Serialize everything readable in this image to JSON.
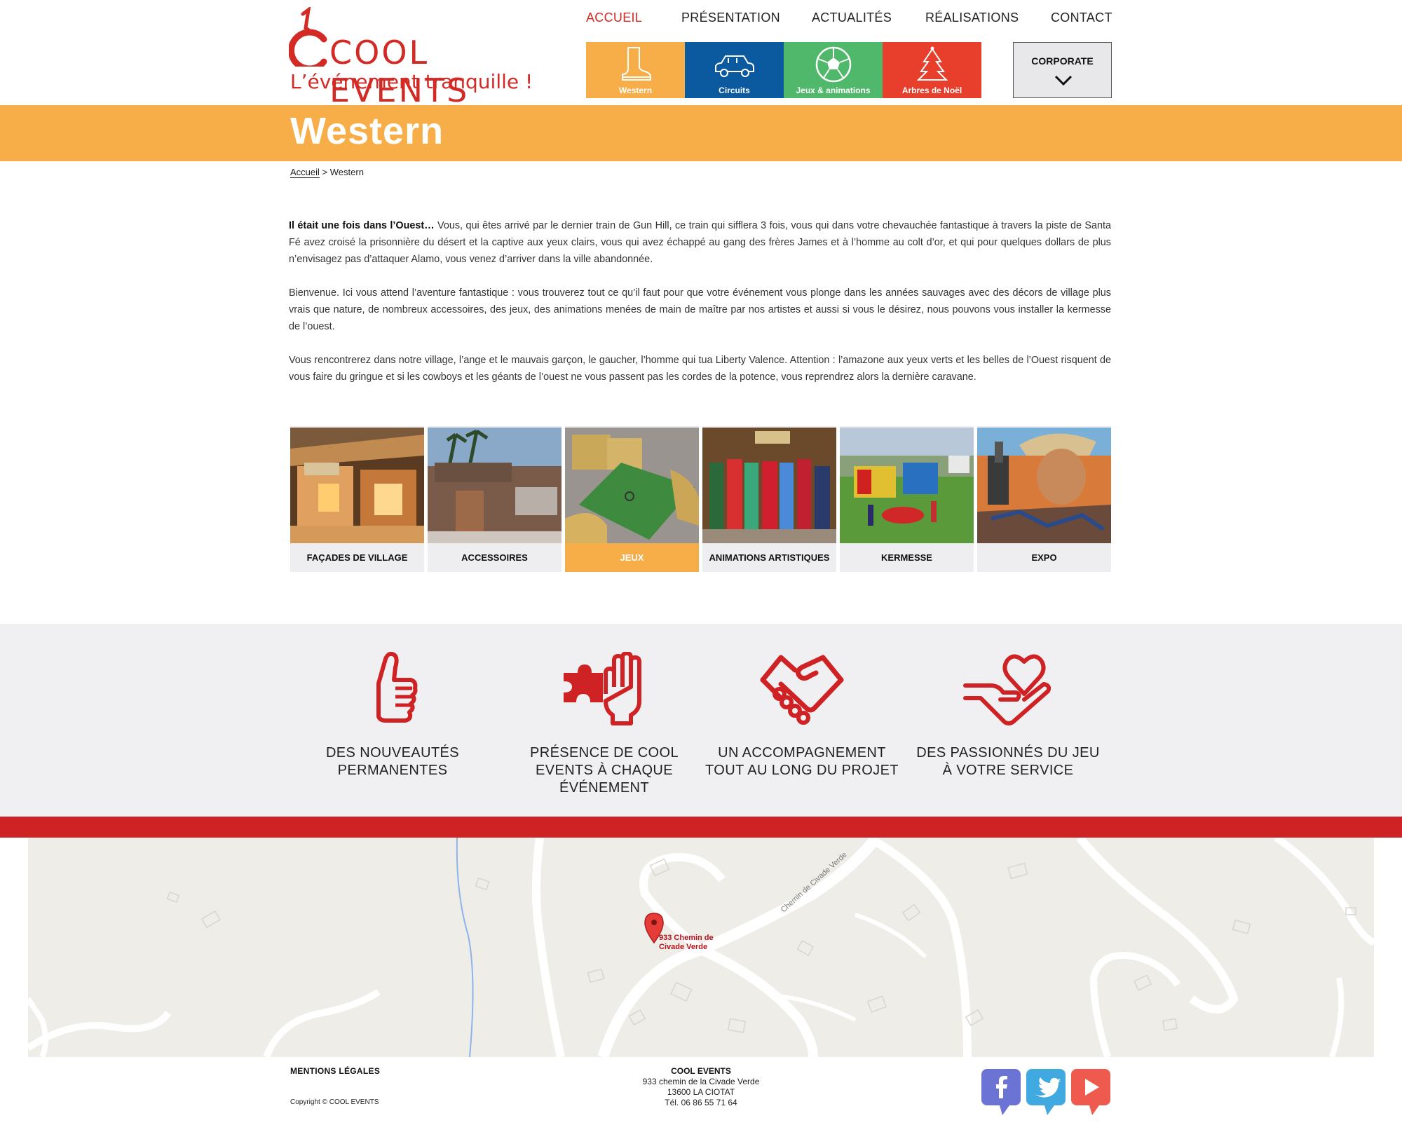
{
  "brand": {
    "name": "COOL EVENTS",
    "tagline": "L’événement tranquille !",
    "accent": "#d42a25",
    "orange": "#f7ae48"
  },
  "nav": {
    "items": [
      {
        "label": "ACCUEIL",
        "active": true
      },
      {
        "label": "PRÉSENTATION"
      },
      {
        "label": "ACTUALITÉS"
      },
      {
        "label": "RÉALISATIONS"
      },
      {
        "label": "CONTACT"
      }
    ]
  },
  "categories": [
    {
      "label": "Western",
      "icon": "cowboy-boot-icon",
      "color": "#f7ae48"
    },
    {
      "label": "Circuits",
      "icon": "car-icon",
      "color": "#0b5aa0"
    },
    {
      "label": "Jeux & animations",
      "icon": "soccer-ball-icon",
      "color": "#4fb86b"
    },
    {
      "label": "Arbres de Noël",
      "icon": "christmas-tree-icon",
      "color": "#e83e2c"
    }
  ],
  "corporate": {
    "label": "CORPORATE",
    "icon": "chevron-down-icon"
  },
  "page": {
    "title": "Western"
  },
  "breadcrumb": {
    "home": "Accueil",
    "sep": ">",
    "current": "Western"
  },
  "content": {
    "p1_lead": "Il était une fois dans l’Ouest…",
    "p1_body": " Vous, qui êtes arrivé par le dernier train de Gun Hill, ce train qui sifflera 3 fois, vous qui dans votre chevauchée fantastique à travers la piste de Santa Fé  avez croisé la prisonnière du désert et la captive aux yeux clairs, vous qui avez échappé au gang des frères James et à l’homme au colt d’or, et qui pour quelques dollars de plus n’envisagez pas d’attaquer Alamo, vous venez d’arriver dans la ville abandonnée.",
    "p2": "Bienvenue. Ici vous attend l’aventure fantastique : vous trouverez tout ce qu’il faut pour que votre événement vous plonge dans les années sauvages avec des décors de village plus vrais que nature, de nombreux accessoires, des jeux, des animations menées de main de maître par nos artistes et aussi si vous le désirez, nous pouvons vous installer la kermesse de l’ouest.",
    "p3": "Vous rencontrerez dans  notre village, l’ange et le mauvais garçon, le gaucher, l’homme qui tua Liberty Valence. Attention : l’amazone aux yeux verts  et les belles de l’Ouest risquent de vous faire du gringue et si  les cowboys et  les géants de l’ouest ne vous passent pas les cordes de la potence, vous reprendrez alors la dernière caravane."
  },
  "gallery": [
    {
      "caption": "FAÇADES DE VILLAGE"
    },
    {
      "caption": "ACCESSOIRES"
    },
    {
      "caption": "JEUX",
      "active": true
    },
    {
      "caption": "ANIMATIONS ARTISTIQUES"
    },
    {
      "caption": "KERMESSE"
    },
    {
      "caption": "EXPO"
    }
  ],
  "features": [
    {
      "label": "DES NOUVEAUTÉS PERMANENTES",
      "icon": "thumbs-up-icon"
    },
    {
      "label": "PRÉSENCE DE COOL EVENTS À CHAQUE ÉVÉNEMENT",
      "icon": "puzzle-hand-icon"
    },
    {
      "label": "UN ACCOMPAGNEMENT TOUT AU LONG DU PROJET",
      "icon": "handshake-icon"
    },
    {
      "label": "DES PASSIONNÉS DU JEU À VOTRE SERVICE",
      "icon": "heart-hand-icon"
    }
  ],
  "map": {
    "pin_label_1": "933 Chemin de",
    "pin_label_2": "Civade Verde",
    "road_label": "Chemin de Civade Verde"
  },
  "footer": {
    "legal": "MENTIONS LÉGALES",
    "copyright": "Copyright © COOL EVENTS",
    "company": "COOL EVENTS",
    "address1": "933 chemin de la Civade Verde",
    "address2": "13600 LA CIOTAT",
    "phone": "Tél. 06 86 55 71 64"
  },
  "social": [
    {
      "name": "facebook-icon",
      "color": "#6b73d4"
    },
    {
      "name": "twitter-icon",
      "color": "#3fa9e0"
    },
    {
      "name": "youtube-icon",
      "color": "#ee5a4e"
    }
  ]
}
